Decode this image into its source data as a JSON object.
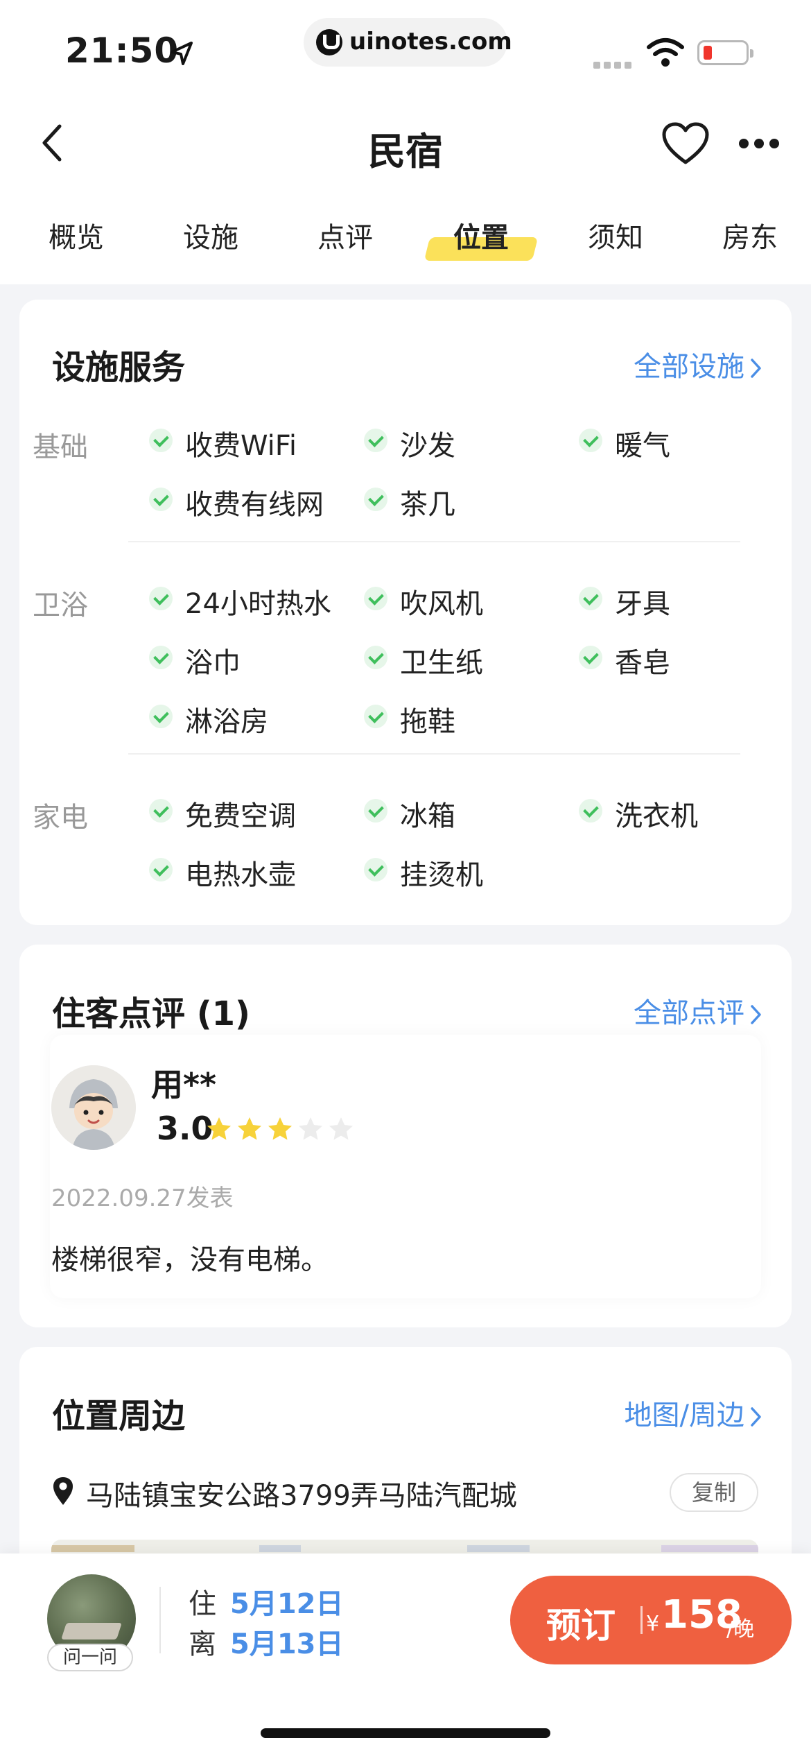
{
  "status_bar": {
    "time": "21:50",
    "url": "uinotes.com"
  },
  "nav": {
    "title": "民宿"
  },
  "tabs": [
    {
      "label": "概览"
    },
    {
      "label": "设施"
    },
    {
      "label": "点评"
    },
    {
      "label": "位置",
      "active": true
    },
    {
      "label": "须知"
    },
    {
      "label": "房东"
    }
  ],
  "facilities": {
    "title": "设施服务",
    "link": "全部设施",
    "groups": [
      {
        "label": "基础",
        "items": [
          "收费WiFi",
          "沙发",
          "暖气",
          "收费有线网",
          "茶几"
        ]
      },
      {
        "label": "卫浴",
        "items": [
          "24小时热水",
          "吹风机",
          "牙具",
          "浴巾",
          "卫生纸",
          "香皂",
          "淋浴房",
          "拖鞋"
        ]
      },
      {
        "label": "家电",
        "items": [
          "免费空调",
          "冰箱",
          "洗衣机",
          "电热水壶",
          "挂烫机"
        ]
      }
    ]
  },
  "reviews": {
    "title": "住客点评 (1)",
    "link": "全部点评",
    "items": [
      {
        "user": "用**",
        "score": "3.0",
        "stars": 3,
        "max_stars": 5,
        "date": "2022.09.27发表",
        "text": "楼梯很窄，没有电梯。"
      }
    ]
  },
  "location": {
    "title": "位置周边",
    "link": "地图/周边",
    "address": "马陆镇宝安公路3799弄马陆汽配城",
    "copy_label": "复制"
  },
  "bottom_bar": {
    "ask_label": "问一问",
    "checkin_key": "住",
    "checkin_date": "5月12日",
    "checkout_key": "离",
    "checkout_date": "5月13日",
    "book_label": "预订",
    "currency": "¥",
    "price": "158",
    "unit": "/晚"
  },
  "colors": {
    "accent_blue": "#4a8ee6",
    "book_orange": "#ef6040",
    "check_green": "#3fbf5c",
    "star_yellow": "#f7d23a",
    "tab_highlight": "#fbe15a"
  }
}
